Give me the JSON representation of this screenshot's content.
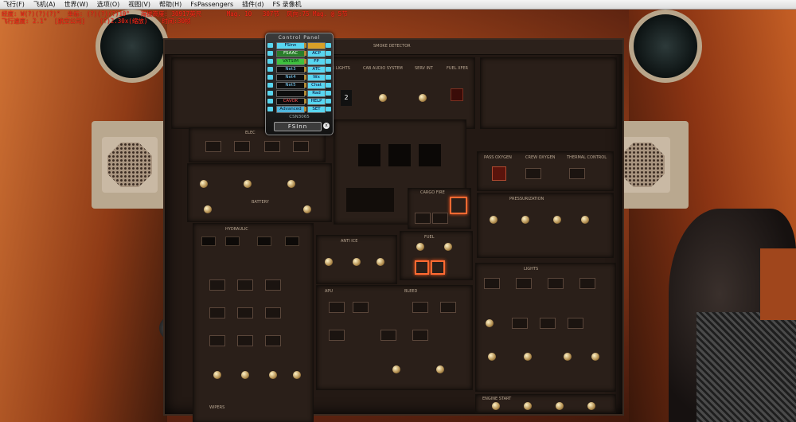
{
  "menu": [
    "飞行(F)",
    "飞机(A)",
    "世界(W)",
    "选项(O)",
    "视图(V)",
    "帮助(H)",
    "FsPassengers",
    "插件(d)",
    "FS 录像机"
  ],
  "status": {
    "line1": "经度: W(?)(?)(?)°  坐标: (?)(?)(?)10°   海拔高度: 30917英尺       Mag. 10   307节  风向:75 Mag. @ 5节",
    "line2": "飞行速度: 2.1°  [航空公司]    (?)2.30x(缩放)    时间:30帧"
  },
  "control_panel": {
    "title": "Control Panel",
    "rows": [
      {
        "left": "FSinn",
        "right": "",
        "left_bg": "#58d6f0",
        "left_fg": "#002"
      },
      {
        "left": "FSAAC",
        "right": "ACP",
        "left_bg": "#2a7d2a",
        "left_fg": "#e8ffe8"
      },
      {
        "left": "VATSIM",
        "right": "FP",
        "left_bg": "#3fbf3f",
        "left_fg": "#031"
      },
      {
        "left": "Net3",
        "right": "ATC",
        "left_bg": "#0d0d0d",
        "left_fg": "#7fd4ff"
      },
      {
        "left": "Net4",
        "right": "Wx",
        "left_bg": "#0d0d0d",
        "left_fg": "#7fd4ff"
      },
      {
        "left": "Net5",
        "right": "Chat",
        "left_bg": "#0d0d0d",
        "left_fg": "#7fd4ff"
      },
      {
        "left": "",
        "right": "Rad",
        "left_bg": "#0d0d0d",
        "left_fg": "#7fd4ff"
      },
      {
        "left": "CAVOK",
        "right": "HELP",
        "left_bg": "#0d0d0d",
        "left_fg": "#ff5050"
      },
      {
        "left": "Advanced",
        "right": "SET",
        "left_bg": "#4fb6de",
        "left_fg": "#012"
      }
    ],
    "callsign": "CSN3065",
    "brand": "FSInn",
    "close_label": "x"
  },
  "overhead": {
    "labels": [
      "SMOKE DETECTOR",
      "EMER LIGHTS",
      "CAB AUDIO SYSTEM",
      "SERV INT",
      "FUEL XFER",
      "ELEC",
      "PASS OXYGEN",
      "CREW OXYGEN",
      "THERMAL CONTROL",
      "CARGO FIRE",
      "BATTERY",
      "HYDRAULIC",
      "FUEL",
      "APU",
      "ANTI ICE",
      "BLEED",
      "PRESSURIZATION",
      "LIGHTS",
      "ENGINE START",
      "WIPERS"
    ],
    "display_digit": "2"
  }
}
